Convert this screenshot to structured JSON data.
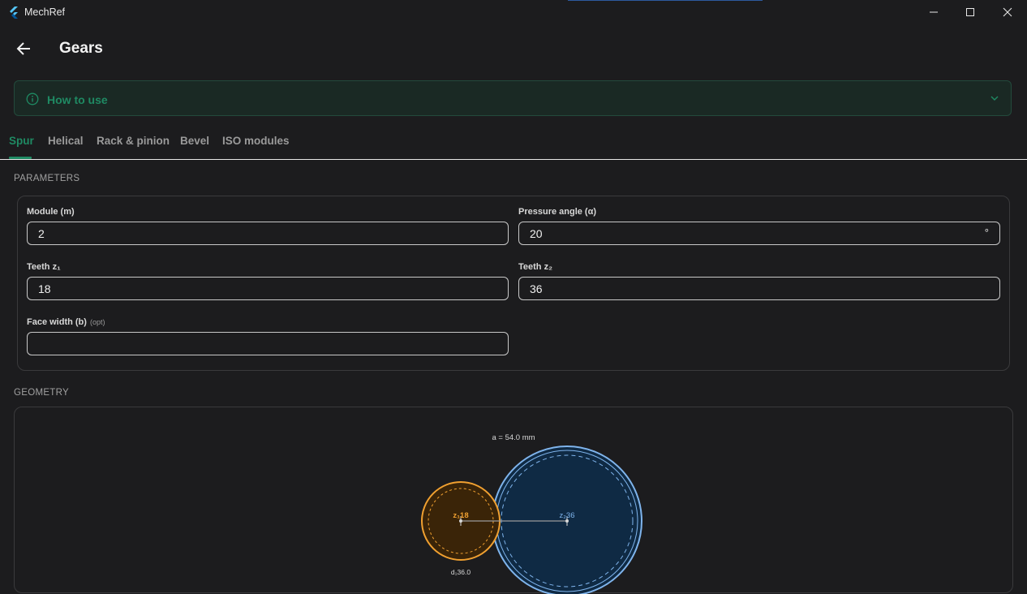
{
  "window": {
    "title": "MechRef"
  },
  "appbar": {
    "title": "Gears"
  },
  "how_to_use": {
    "label": "How to use"
  },
  "tabs": [
    {
      "label": "Spur",
      "active": true
    },
    {
      "label": "Helical",
      "active": false
    },
    {
      "label": "Rack & pinion",
      "active": false
    },
    {
      "label": "Bevel",
      "active": false
    },
    {
      "label": "ISO modules",
      "active": false
    }
  ],
  "parameters": {
    "section_label": "PARAMETERS",
    "module": {
      "label": "Module (m)",
      "value": "2"
    },
    "pressure_angle": {
      "label": "Pressure angle (α)",
      "value": "20",
      "suffix": "°"
    },
    "teeth_z1": {
      "label": "Teeth z₁",
      "value": "18"
    },
    "teeth_z2": {
      "label": "Teeth z₂",
      "value": "36"
    },
    "face_width": {
      "label": "Face width (b)",
      "opt": "(opt)",
      "value": ""
    }
  },
  "geometry": {
    "section_label": "GEOMETRY",
    "center_distance_label": "a = 54.0 mm",
    "gear1_label": "z₁18",
    "gear2_label": "z₂36",
    "d1_label": "d₁36.0"
  },
  "colors": {
    "accent": "#1f8a63",
    "gear1": "#f0a030",
    "gear2": "#7fb4ec"
  }
}
